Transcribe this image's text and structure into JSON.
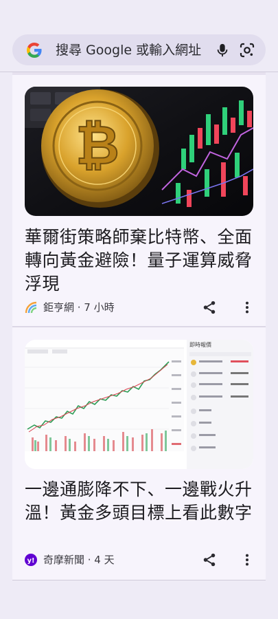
{
  "search": {
    "placeholder": "搜尋 Google 或輸入網址"
  },
  "colors": {
    "background": "#eeebf6",
    "search_bar": "#e1ddee",
    "card": "#f7f4fc",
    "gold": "#c89b2c",
    "candle_up": "#2fd07a",
    "candle_down": "#f0455a"
  },
  "icons": {
    "logo": "google-g",
    "voice": "mic-icon",
    "camera": "google-lens-icon",
    "share": "share-icon",
    "more": "more-vert-icon"
  },
  "feed": {
    "cards": [
      {
        "title": "華爾街策略師棄比特幣、全面轉向黃金避險！量子運算威脅浮現",
        "source": "鉅亨網",
        "time": "7 小時",
        "meta": "鉅亨網 · 7 小時",
        "image": "bitcoin-coin-with-candlestick-chart"
      },
      {
        "title": "一邊通膨降不下、一邊戰火升溫！黃金多頭目標上看此數字",
        "source": "奇摩新聞",
        "time": "4 天",
        "meta": "奇摩新聞 · 4 天",
        "image": "gold-price-trading-chart-screenshot",
        "image_panel_title": "即時報價"
      }
    ]
  }
}
